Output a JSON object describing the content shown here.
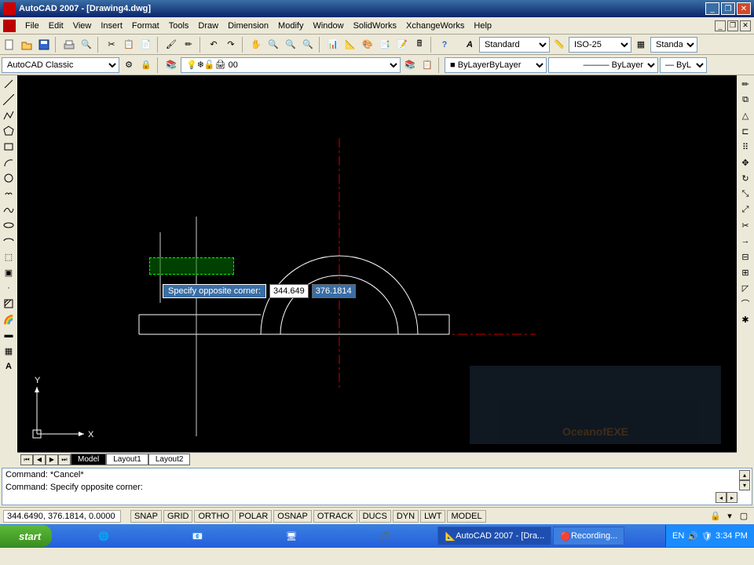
{
  "titlebar": {
    "title": "AutoCAD 2007 - [Drawing4.dwg]"
  },
  "menu": [
    "File",
    "Edit",
    "View",
    "Insert",
    "Format",
    "Tools",
    "Draw",
    "Dimension",
    "Modify",
    "Window",
    "SolidWorks",
    "XchangeWorks",
    "Help"
  ],
  "toolbar1": {
    "style_select": "Standard",
    "dim_select": "ISO-25",
    "std_select": "Standard"
  },
  "toolbar2": {
    "workspace": "AutoCAD Classic",
    "layer": "0",
    "color": "ByLayer",
    "linetype": "ByLayer",
    "lineweight": "ByL"
  },
  "canvas": {
    "tooltip_label": "Specify opposite corner:",
    "tooltip_x": "344.649",
    "tooltip_y": "376.1814",
    "ucs_x": "X",
    "ucs_y": "Y",
    "watermark": "OceanofEXE"
  },
  "tabs": [
    "Model",
    "Layout1",
    "Layout2"
  ],
  "cmd": {
    "line1": "Command: *Cancel*",
    "line2": "Command: Specify opposite corner:"
  },
  "status": {
    "coords": "344.6490, 376.1814, 0.0000",
    "buttons": [
      "SNAP",
      "GRID",
      "ORTHO",
      "POLAR",
      "OSNAP",
      "OTRACK",
      "DUCS",
      "DYN",
      "LWT",
      "MODEL"
    ]
  },
  "taskbar": {
    "start": "start",
    "items": [
      "AutoCAD 2007 - [Dra...",
      "Recording..."
    ],
    "lang": "EN",
    "time": "3:34 PM"
  }
}
